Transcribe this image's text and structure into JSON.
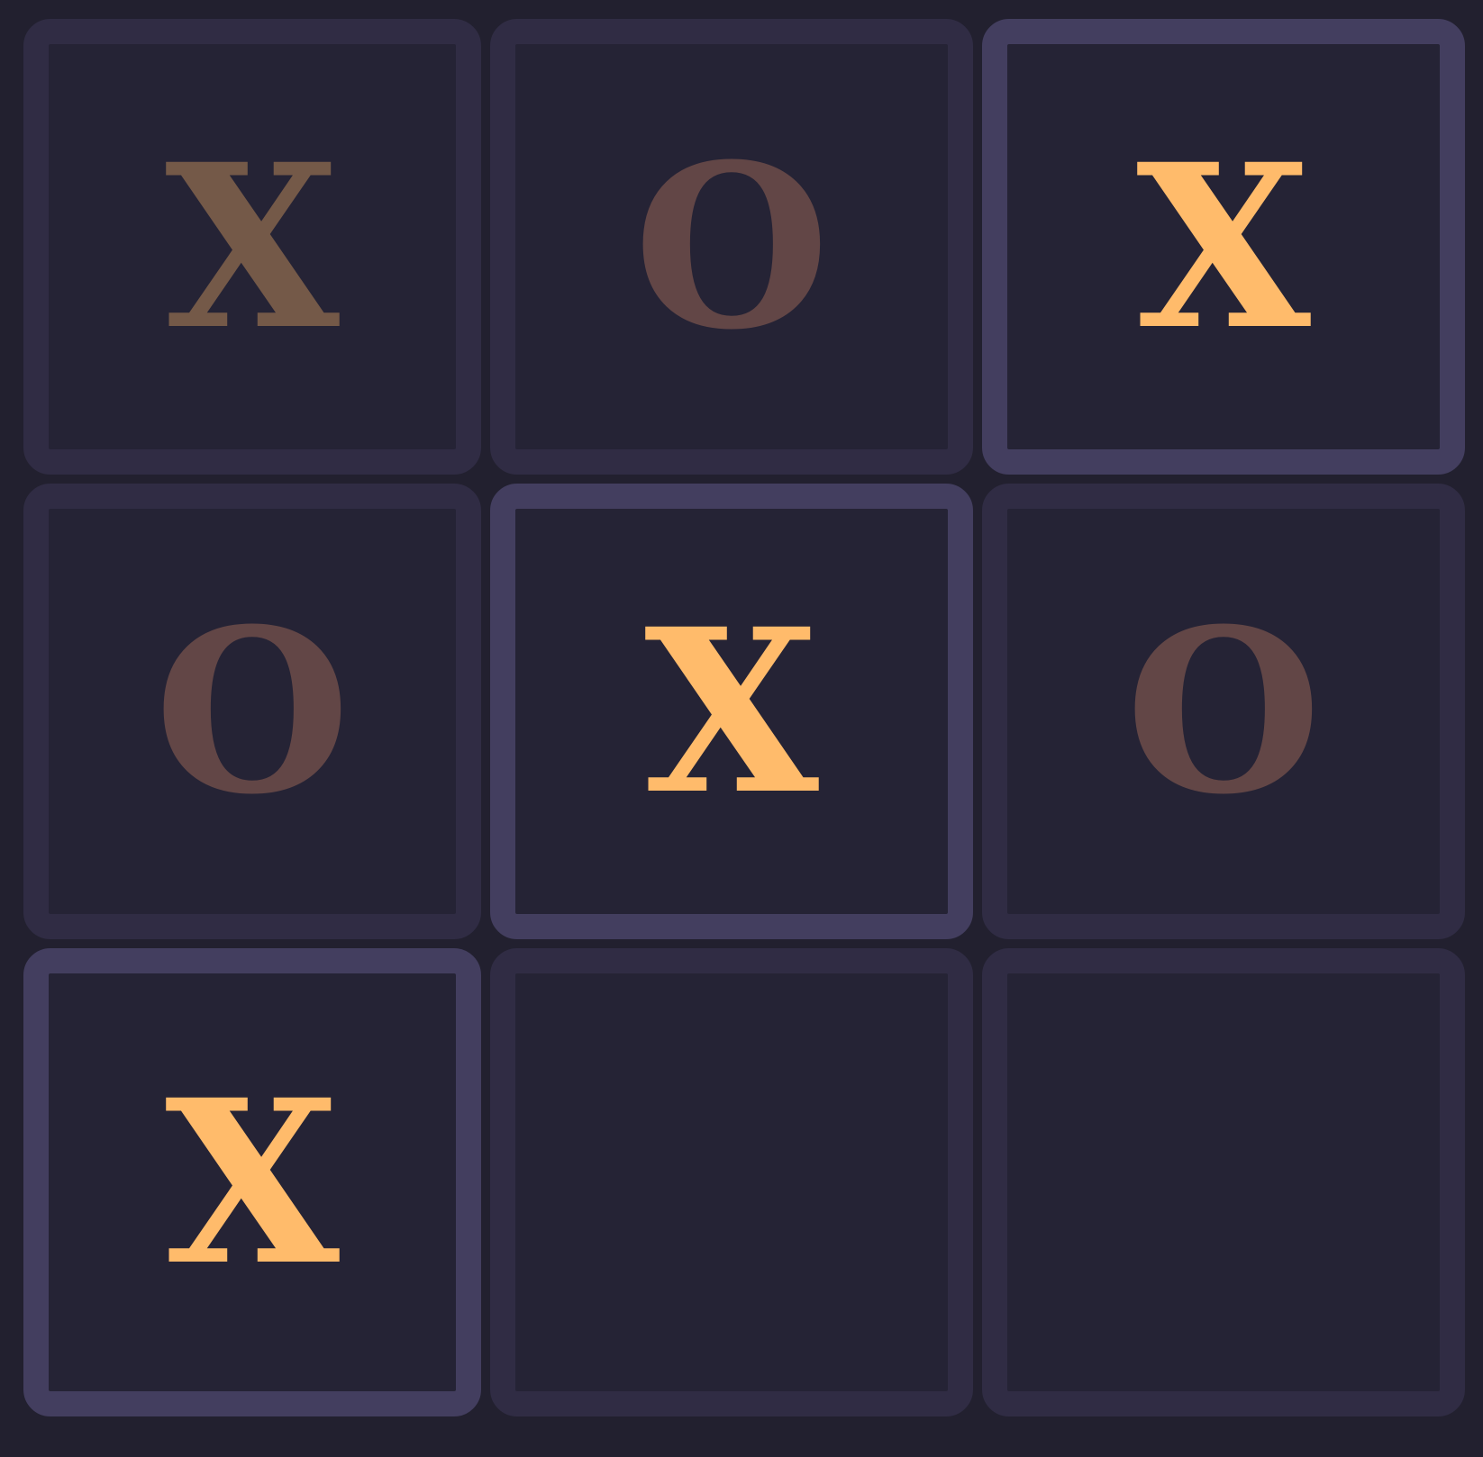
{
  "board": {
    "cells": [
      {
        "mark": "X",
        "state": "dim"
      },
      {
        "mark": "O",
        "state": "normal"
      },
      {
        "mark": "X",
        "state": "win"
      },
      {
        "mark": "O",
        "state": "normal"
      },
      {
        "mark": "X",
        "state": "win"
      },
      {
        "mark": "O",
        "state": "normal"
      },
      {
        "mark": "X",
        "state": "win"
      },
      {
        "mark": "",
        "state": "empty"
      },
      {
        "mark": "",
        "state": "empty"
      }
    ],
    "winning_line": [
      2,
      4,
      6
    ]
  },
  "colors": {
    "background": "#22202f",
    "cell_fill": "#252335",
    "cell_border": "#302c44",
    "win_border": "#433e5f",
    "x_active": "#ffbb6b",
    "x_dim": "#745948",
    "o": "#624646"
  }
}
